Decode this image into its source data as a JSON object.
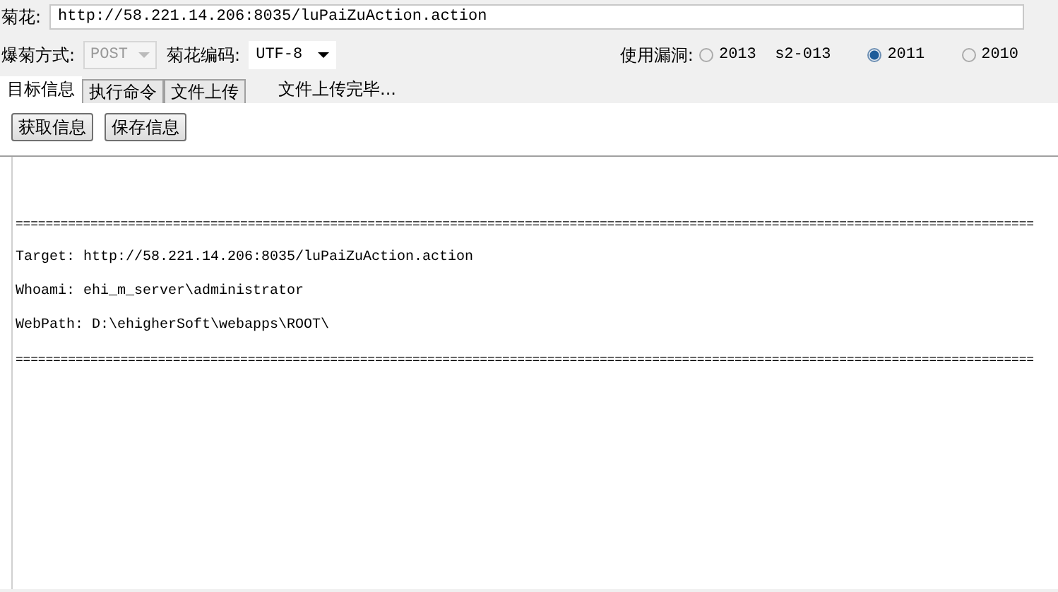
{
  "url_field": {
    "label": "菊花:",
    "value": "http://58.221.14.206:8035/luPaiZuAction.action"
  },
  "method": {
    "label": "爆菊方式:",
    "value": "POST",
    "disabled": true
  },
  "encoding": {
    "label": "菊花编码:",
    "value": "UTF-8",
    "disabled": false
  },
  "exploit": {
    "label": "使用漏洞:",
    "options": [
      {
        "label": "2013  s2-013",
        "selected": false
      },
      {
        "label": "2011",
        "selected": true
      },
      {
        "label": "2010",
        "selected": false
      }
    ]
  },
  "tabs": [
    {
      "label": "目标信息",
      "selected": true
    },
    {
      "label": "执行命令",
      "selected": false
    },
    {
      "label": "文件上传",
      "selected": false
    }
  ],
  "status": "文件上传完毕...",
  "buttons": [
    "获取信息",
    "保存信息"
  ],
  "output": [
    {
      "kind": "rule",
      "text": "========================================================================================================================================"
    },
    {
      "kind": "line",
      "text": "Target: http://58.221.14.206:8035/luPaiZuAction.action"
    },
    {
      "kind": "line",
      "text": "Whoami: ehi_m_server\\administrator"
    },
    {
      "kind": "line",
      "text": "WebPath: D:\\ehigherSoft\\webapps\\ROOT\\"
    },
    {
      "kind": "rule",
      "text": "========================================================================================================================================"
    }
  ]
}
